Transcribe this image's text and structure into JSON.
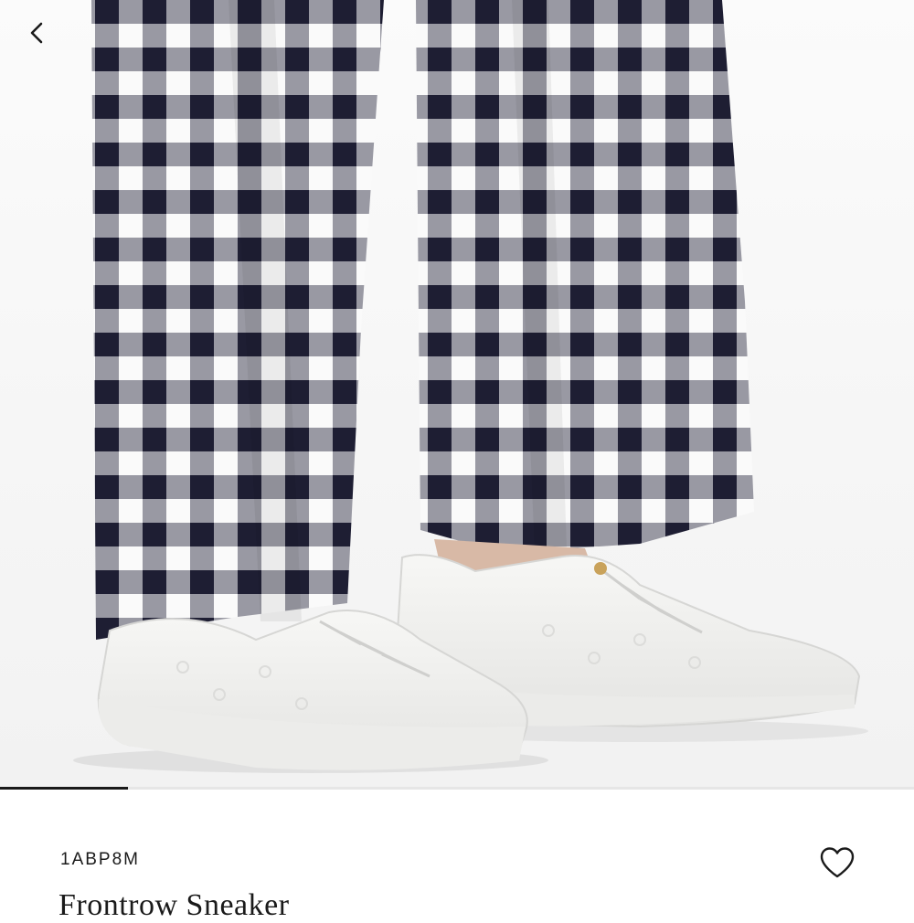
{
  "header": {
    "back_icon": "chevron-left-icon"
  },
  "gallery": {
    "image_description": "model-wearing-checked-trousers-and-white-sneakers",
    "progress": 0.14,
    "trouser_dark": "#23233a",
    "trouser_light": "#fafafa",
    "shoe_color": "#f4f4f2"
  },
  "product": {
    "sku": "1ABP8M",
    "name": "Frontrow Sneaker",
    "wishlist_icon": "heart-outline-icon"
  }
}
